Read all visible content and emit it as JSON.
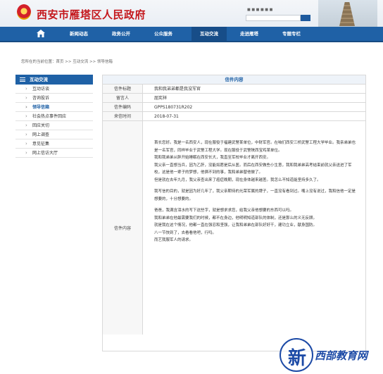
{
  "header": {
    "site_title": "西安市雁塔区人民政府",
    "top_links": "■ ■ ■ ■ ■ ■"
  },
  "nav": {
    "items": [
      "新闻动态",
      "政务公开",
      "公众服务",
      "互动交流",
      "走进雁塔",
      "专题专栏"
    ],
    "active_index": 3
  },
  "breadcrumb": "您所在的当前位置：首页 >> 互动交流 >> 领导信箱",
  "sidebar": {
    "title": "互动交流",
    "items": [
      "互动访谈",
      "咨询投诉",
      "领导信箱",
      "社会热点事件回应",
      "回应关切",
      "网上调查",
      "意见征集",
      "网上信访大厅"
    ],
    "active_index": 2
  },
  "letter": {
    "section_title": "信件内容",
    "rows": [
      {
        "label": "信件标题",
        "value": "我和我弟弟都是我没军官"
      },
      {
        "label": "留言人",
        "value": "屈宪祥"
      },
      {
        "label": "信件编码",
        "value": "GPPS180731R202"
      },
      {
        "label": "来信时间",
        "value": "2018-07-31"
      }
    ],
    "content_label": "信件内容",
    "paragraphs": [
      "首长您好。我是一名西安人，现在服役于福建武警某单位，中财军官。在咱们西安三桥武警工程大学毕业。我亲弟弟也是一名军官，同样毕业于武警工程大学。现在服役于武警陕西宝鸡某单位。",
      "我和我弟弟从胖开始睡眠在西安长大，我直至军校毕业才离开西安。",
      "我父亲一直想当兵，因为乙肝，没能如愿是后从医。而后在西安做些小生意，我和我弟弟高考结束前就父亲送进了军校，这是他一辈子的梦想，他俩不到的事，我和弟弟替他做了。",
      "但是就在去年九月，我父亲查出来了癌症晚期，现在身体越来越差。我怎么不知道能坚持多久了。",
      "我写信的目的，就是因为好几年了，我父亲期待的光荣军属的牌子，一直没有看到过。嘴上没有说过，我和信他一定是想要的，十分想要的。",
      "爸爸，我满含泪水的写下这些字，就是想求求您，给我父亲他想要的东西可以吗。",
      "我和弟弟在他最需要我们的时候，都不在身边，他明明知道部队的体制，还是那么的义无反顾。",
      "就是我在这个情况，他都一直在强忍和坚强，让我和弟弟在部队好好干，建功立业，献身国防。",
      "八一节快到了，去看看他吧，行吗。",
      "而艺我服军人的请求。"
    ]
  },
  "watermark": {
    "char": "新",
    "text": "西部教育网"
  },
  "colors": {
    "brand_red": "#c4171c",
    "nav_blue": "#1f61a6"
  }
}
